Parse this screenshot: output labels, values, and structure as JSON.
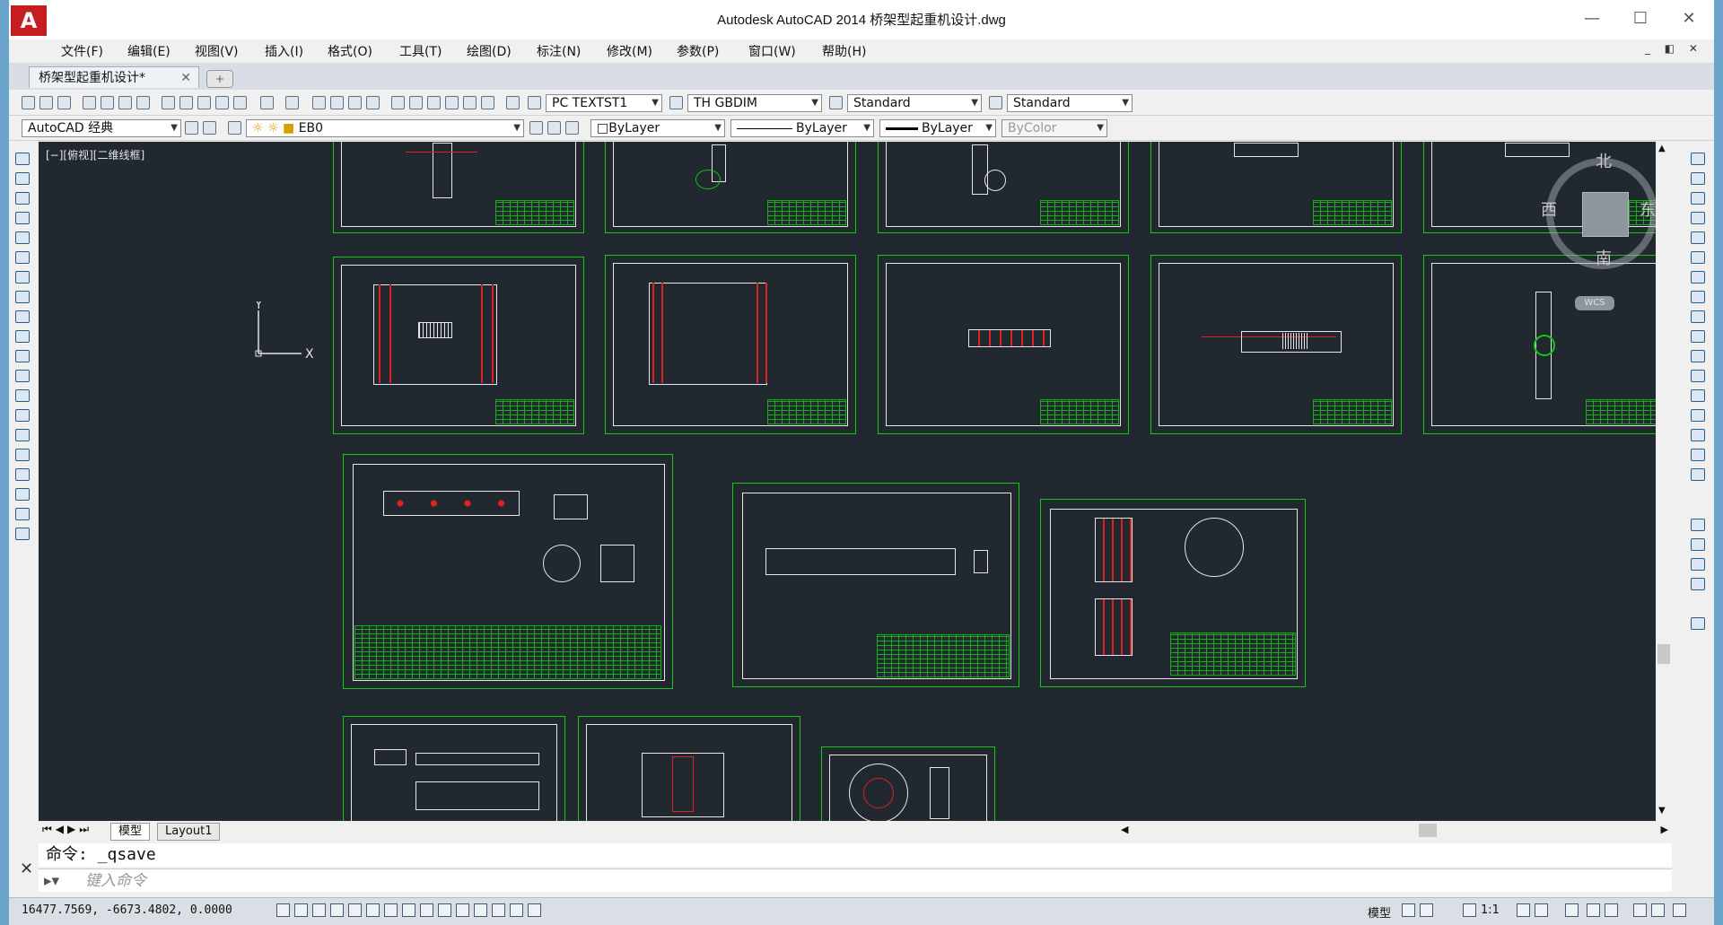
{
  "window": {
    "title": "Autodesk AutoCAD 2014    桥架型起重机设计.dwg",
    "logo": "A",
    "minimize": "—",
    "maximize": "☐",
    "close": "✕"
  },
  "menu": [
    "文件(F)",
    "编辑(E)",
    "视图(V)",
    "插入(I)",
    "格式(O)",
    "工具(T)",
    "绘图(D)",
    "标注(N)",
    "修改(M)",
    "参数(P)",
    "窗口(W)",
    "帮助(H)"
  ],
  "doc_controls": "_ ◧ ✕",
  "tabs": {
    "active": "桥架型起重机设计*",
    "close": "✕",
    "new": "+"
  },
  "toolbar1": {
    "text_style": "PC TEXTST1",
    "dim_style": "TH GBDIM",
    "table_style": "Standard",
    "mleader_style": "Standard"
  },
  "toolbar2": {
    "workspace": "AutoCAD 经典",
    "layer": "EB0",
    "color": "ByLayer",
    "linetype": "ByLayer",
    "lineweight": "ByLayer",
    "plotstyle": "ByColor"
  },
  "viewport": {
    "label": "[−][俯视][二维线框]",
    "ucs_x": "X",
    "ucs_y": "Y"
  },
  "viewcube": {
    "north": "北",
    "south": "南",
    "west": "西",
    "east": "东",
    "wcs": "WCS"
  },
  "layout_tabs": [
    "模型",
    "Layout1"
  ],
  "command": {
    "history": "命令:  _qsave",
    "placeholder": "键入命令"
  },
  "status": {
    "coords": "16477.7569, -6673.4802, 0.0000",
    "model": "模型",
    "scale": "1:1"
  },
  "colors": {
    "canvas": "#212830",
    "frame": "#14c814",
    "inner": "#e6e6e6",
    "accent": "#c41e1e"
  }
}
